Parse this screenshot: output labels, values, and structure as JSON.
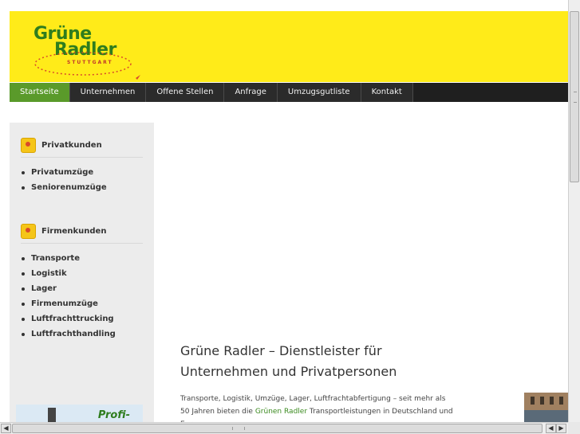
{
  "header": {
    "logo_line1": "Grüne",
    "logo_line2": "Radler",
    "logo_sub": "STUTTGART",
    "brand_yellow": "#ffeb19",
    "brand_green": "#2f7d1e"
  },
  "nav": {
    "items": [
      "Startseite",
      "Unternehmen",
      "Offene Stellen",
      "Anfrage",
      "Umzugsgutliste",
      "Kontakt"
    ],
    "active": "Startseite",
    "active_color": "#5a9a2a"
  },
  "sidebar": {
    "privat": {
      "title": "Privatkunden",
      "items": [
        "Privatumzüge",
        "Seniorenumzüge"
      ]
    },
    "firmen": {
      "title": "Firmenkunden",
      "items": [
        "Transporte",
        "Logistik",
        "Lager",
        "Firmenumzüge",
        "Luftfrachttrucking",
        "Luftfrachthandling"
      ]
    },
    "banner_text": "Profi-"
  },
  "main": {
    "headline_line1": "Grüne Radler – Dienstleister für",
    "headline_line2": "Unternehmen und Privatpersonen",
    "body_part1": "Transporte, Logistik, Umzüge, Lager, Luftfrachtabfertigung – seit mehr als 50 Jahren bieten die",
    "body_highlight": "Grünen Radler",
    "body_part2": "Transportleistungen in Deutschland und Europa an."
  },
  "scrollbars": {
    "left_arrow": "◀",
    "right_arrow": "▶"
  }
}
